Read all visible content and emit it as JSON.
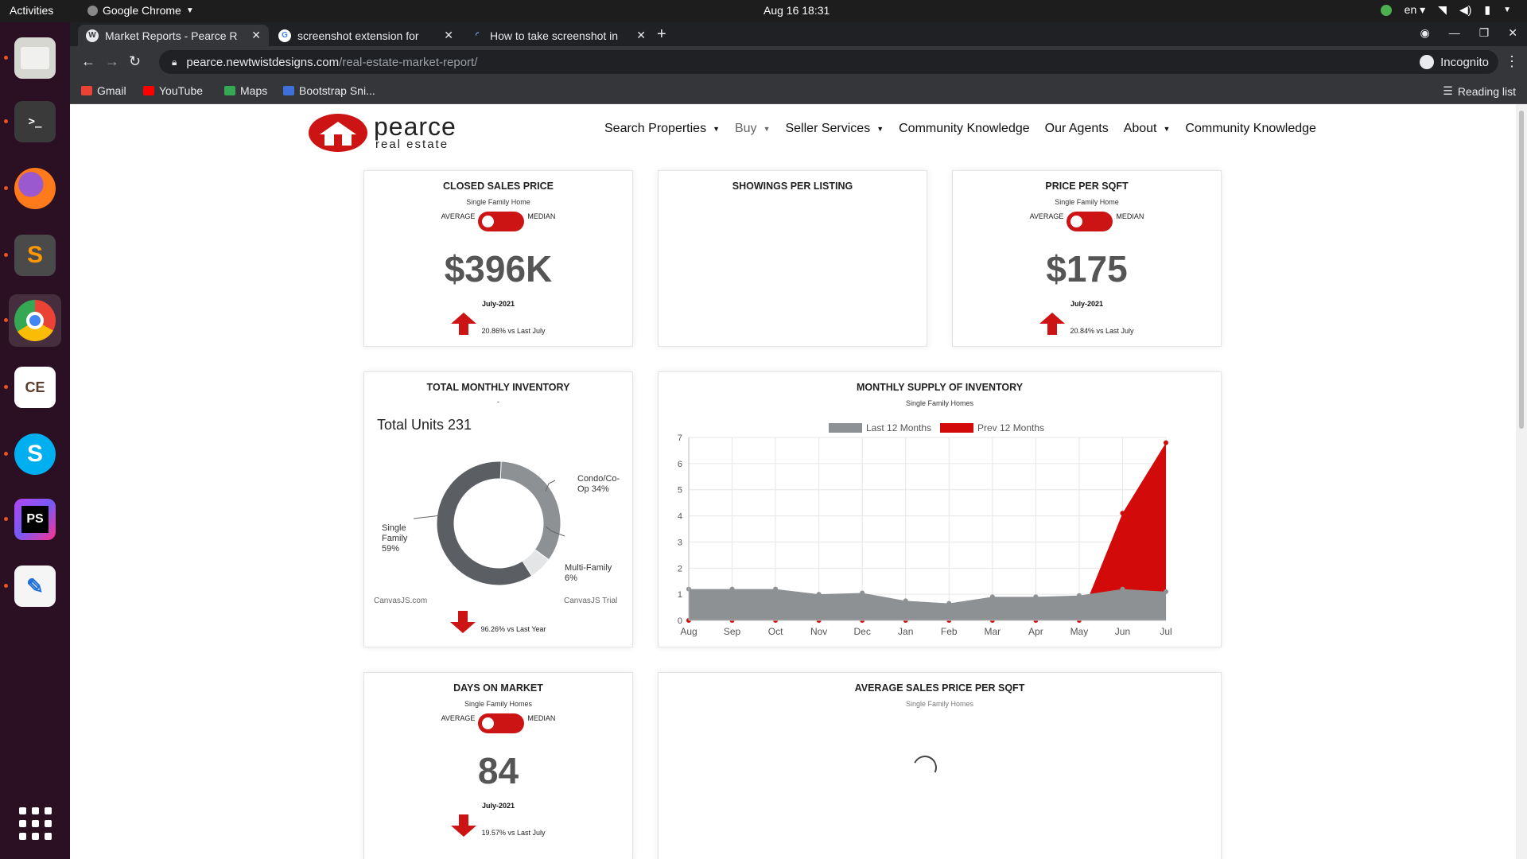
{
  "os": {
    "activities": "Activities",
    "app_name": "Google Chrome",
    "clock": "Aug 16  18:31",
    "lang": "en"
  },
  "browser": {
    "tabs": [
      {
        "title": "Market Reports - Pearce R"
      },
      {
        "title": "screenshot extension for"
      },
      {
        "title": "How to take screenshot in"
      }
    ],
    "url_domain": "pearce.newtwistdesigns.com",
    "url_path": "/real-estate-market-report/",
    "incognito_label": "Incognito",
    "bookmarks": [
      "Gmail",
      "YouTube",
      "Maps",
      "Bootstrap Sni..."
    ],
    "reading_list": "Reading list"
  },
  "site": {
    "logo_word": "pearce",
    "logo_sub": "real estate",
    "nav": [
      "Search Properties",
      "Buy",
      "Seller Services",
      "Community Knowledge",
      "Our Agents",
      "About",
      "Community Knowledge"
    ]
  },
  "cards": {
    "closed_sales": {
      "title": "CLOSED SALES PRICE",
      "subtitle": "Single Family Home",
      "toggle_left": "AVERAGE",
      "toggle_right": "MEDIAN",
      "value": "$396K",
      "period": "July-2021",
      "trend": "20.86% vs Last July"
    },
    "showings": {
      "title": "SHOWINGS PER LISTING"
    },
    "price_sqft": {
      "title": "PRICE PER SQFT",
      "subtitle": "Single Family Home",
      "toggle_left": "AVERAGE",
      "toggle_right": "MEDIAN",
      "value": "$175",
      "period": "July-2021",
      "trend": "20.84% vs Last July"
    },
    "inventory": {
      "title": "TOTAL MONTHLY INVENTORY",
      "dash": "-",
      "total_units": "Total Units 231",
      "label_condo": "Condo/Co-Op  34%",
      "label_single": "Single Family 59%",
      "label_multi": "Multi-Family 6%",
      "watermark_left": "CanvasJS.com",
      "watermark_right": "CanvasJS Trial",
      "trend": "96.26% vs Last Year"
    },
    "supply": {
      "title": "MONTHLY SUPPLY OF INVENTORY",
      "subtitle": "Single Family Homes"
    },
    "days_market": {
      "title": "DAYS ON MARKET",
      "subtitle": "Single Family Homes",
      "toggle_left": "AVERAGE",
      "toggle_right": "MEDIAN",
      "value": "84",
      "period": "July-2021",
      "trend": "19.57% vs Last July"
    },
    "avg_sqft": {
      "title": "AVERAGE SALES PRICE PER SQFT",
      "subtitle": "Single Family Homes"
    }
  },
  "chart_data": [
    {
      "type": "pie",
      "categories": [
        "Single Family",
        "Condo/Co-Op",
        "Multi-Family"
      ],
      "values": [
        59,
        34,
        6
      ],
      "colors": [
        "#5b5e62",
        "#8e9194",
        "#e3e5e7"
      ]
    },
    {
      "type": "area",
      "categories": [
        "Aug",
        "Sep",
        "Oct",
        "Nov",
        "Dec",
        "Jan",
        "Feb",
        "Mar",
        "Apr",
        "May",
        "Jun",
        "Jul"
      ],
      "series": [
        {
          "name": "Last 12 Months",
          "color": "#8e9194",
          "values": [
            1.2,
            1.2,
            1.2,
            1.0,
            1.05,
            0.75,
            0.65,
            0.9,
            0.9,
            0.95,
            1.2,
            1.1
          ]
        },
        {
          "name": "Prev 12 Months",
          "color": "#d20a0a",
          "values": [
            0,
            0,
            0,
            0,
            0,
            0,
            0,
            0,
            0,
            0,
            4.1,
            6.8
          ]
        }
      ],
      "ylim": [
        0,
        7
      ],
      "yticks": [
        0,
        1,
        2,
        3,
        4,
        5,
        6,
        7
      ],
      "legend_position": "top-center",
      "grid": true
    }
  ]
}
